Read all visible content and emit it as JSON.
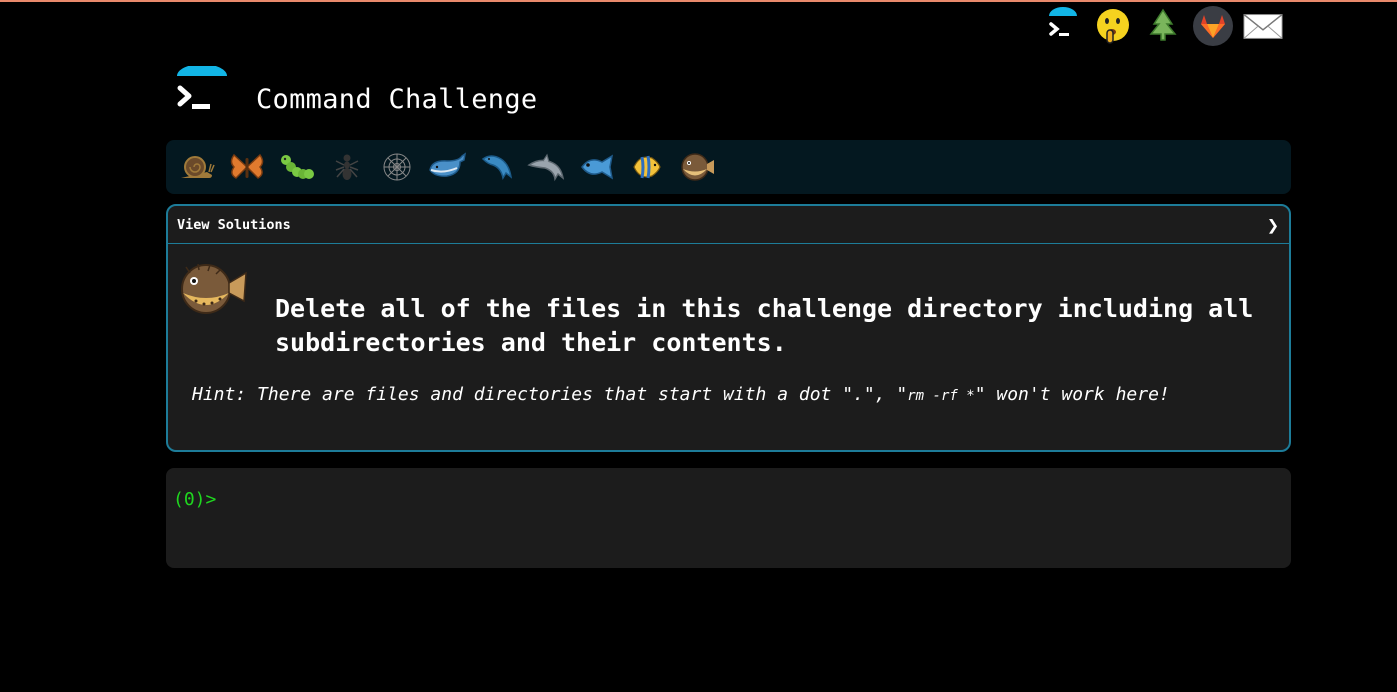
{
  "app": {
    "title": "Command Challenge"
  },
  "top_icons": [
    {
      "name": "terminal-logo-icon"
    },
    {
      "name": "shush-face-icon"
    },
    {
      "name": "tree-icon"
    },
    {
      "name": "gitlab-icon"
    },
    {
      "name": "envelope-icon"
    }
  ],
  "levels": [
    "snail",
    "butterfly",
    "caterpillar",
    "ant",
    "spider-web",
    "whale",
    "dolphin",
    "dolphin-grey",
    "fish",
    "tropical-fish",
    "blowfish"
  ],
  "panel": {
    "header_label": "View Solutions",
    "chevron": "❯",
    "challenge_text": "Delete all of the files in this challenge directory including all subdirectories and their contents.",
    "hint_prefix": "Hint: There are files and directories that start with a dot \".\", \"",
    "hint_code": "rm -rf *",
    "hint_suffix": "\" won't work here!"
  },
  "terminal": {
    "prompt": "(0)>"
  },
  "colors": {
    "accent": "#1d7c99",
    "prompt": "#1fd61f",
    "logo_arc": "#12b5e6"
  }
}
